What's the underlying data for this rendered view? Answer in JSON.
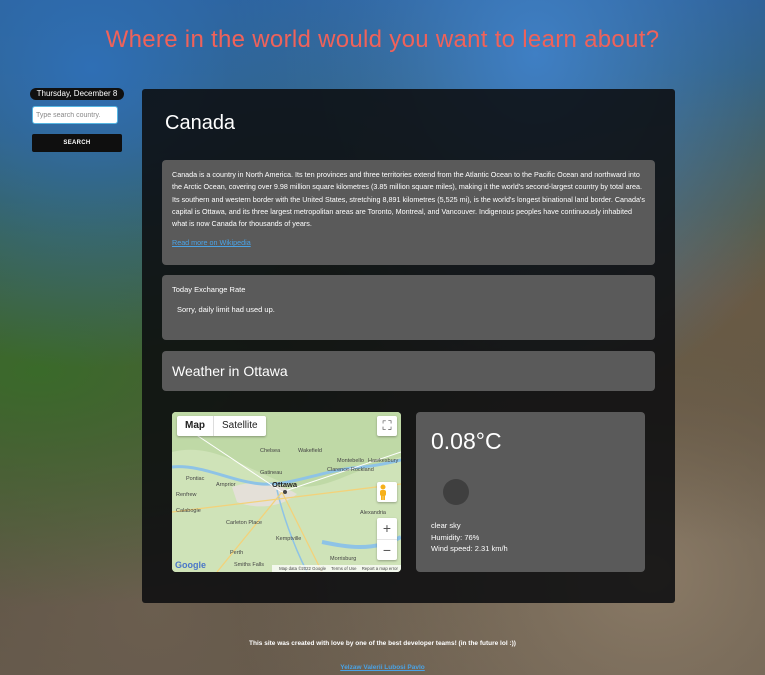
{
  "header": {
    "title": "Where in the world would you want to learn about?"
  },
  "sidebar": {
    "date": "Thursday, December 8",
    "search_placeholder": "Type search country.",
    "search_button": "SEARCH"
  },
  "country": {
    "name": "Canada",
    "description": "Canada is a country in North America. Its ten provinces and three territories extend from the Atlantic Ocean to the Pacific Ocean and northward into the Arctic Ocean, covering over 9.98 million square kilometres (3.85 million square miles), making it the world's second-largest country by total area. Its southern and western border with the United States, stretching 8,891 kilometres (5,525 mi), is the world's longest binational land border. Canada's capital is Ottawa, and its three largest metropolitan areas are Toronto, Montreal, and Vancouver. Indigenous peoples have continuously inhabited what is now Canada for thousands of years.",
    "wiki_link": "Read more on Wikipedia"
  },
  "exchange": {
    "heading": "Today Exchange Rate",
    "message": "Sorry, daily limit had used up."
  },
  "weather": {
    "heading": "Weather in Ottawa",
    "temperature": "0.08°C",
    "condition": "clear sky",
    "humidity": "Humidity: 76%",
    "wind": "Wind speed: 2.31 km/h"
  },
  "map": {
    "tab_map": "Map",
    "tab_satellite": "Satellite",
    "zoom_in": "+",
    "zoom_out": "−",
    "fullscreen": "⛶",
    "logo": "Google",
    "attribution": "Map data ©2022 Google",
    "terms": "Terms of Use",
    "report": "Report a map error",
    "labels": {
      "city": "Ottawa",
      "gatineau": "Gatineau",
      "montebello": "Montebello",
      "chelsea": "Chelsea",
      "clarence": "Clarence-Rockland",
      "hawkesbury": "Hawkesbury",
      "pontiac": "Pontiac",
      "arnprior": "Arnprior",
      "carleton": "Carleton Place",
      "kemptville": "Kemptville",
      "perth": "Perth",
      "smiths": "Smiths Falls",
      "morrisburg": "Morrisburg",
      "renfrew": "Renfrew",
      "calabogie": "Calabogie",
      "wakefield": "Wakefield",
      "alexandria": "Alexandria"
    }
  },
  "footer": {
    "text": "This site was created with love by one of the best developer teams! (in the future lol :))",
    "credits": "Yelzaw Valerii Lubosi Pavlo"
  }
}
